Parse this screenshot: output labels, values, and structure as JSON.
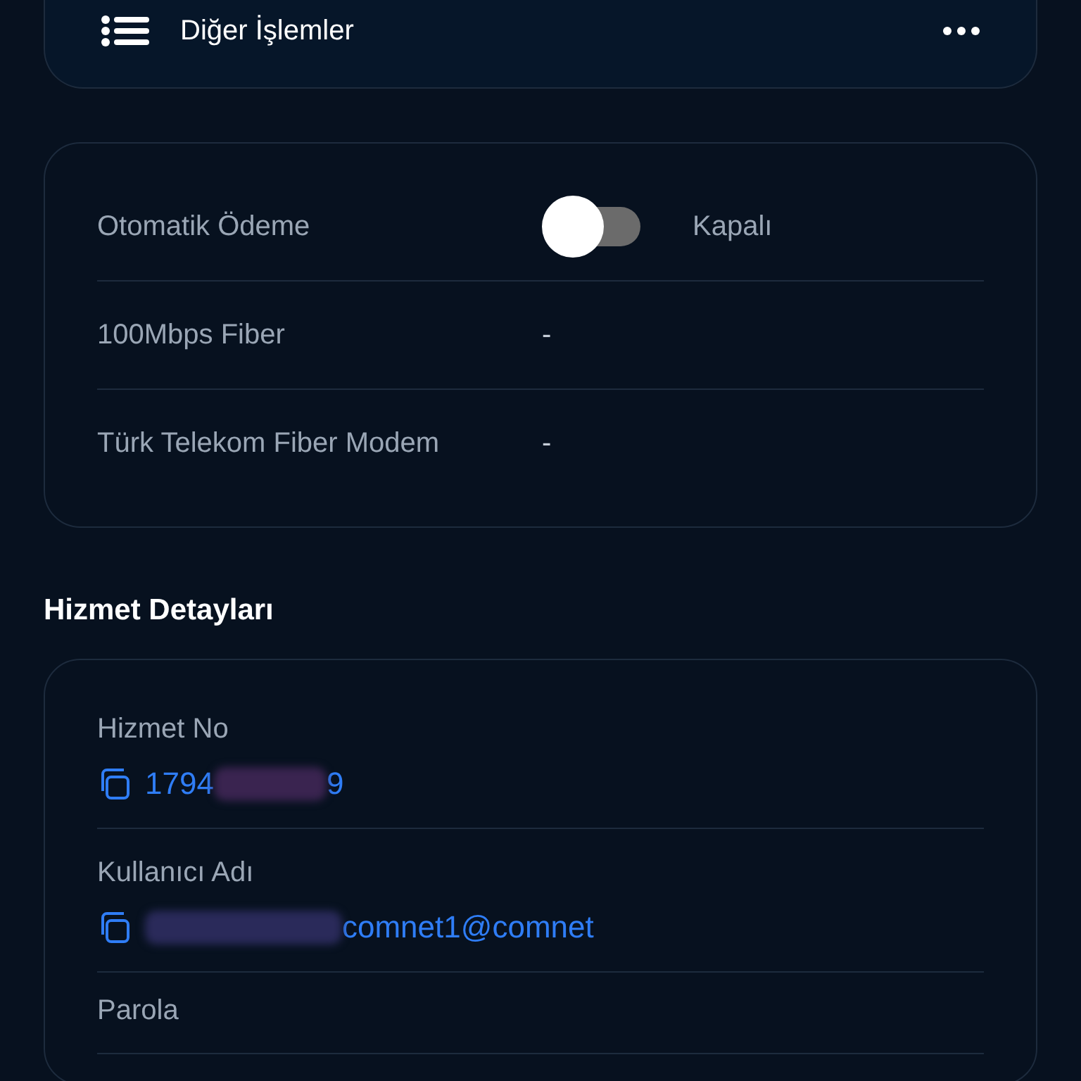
{
  "actions_card": {
    "label": "Diğer İşlemler"
  },
  "settings": [
    {
      "kind": "toggle",
      "label": "Otomatik Ödeme",
      "on": false,
      "status": "Kapalı"
    },
    {
      "kind": "text",
      "label": "100Mbps Fiber",
      "value": "-"
    },
    {
      "kind": "text",
      "label": "Türk Telekom Fiber Modem",
      "value": "-"
    }
  ],
  "service_details": {
    "title": "Hizmet Detayları",
    "fields": [
      {
        "label": "Hizmet No",
        "value_start": "1794",
        "redacted": true,
        "value_end": "9"
      },
      {
        "label": "Kullanıcı Adı",
        "redacted": true,
        "value_end": "comnet1@comnet"
      },
      {
        "label": "Parola"
      }
    ]
  }
}
